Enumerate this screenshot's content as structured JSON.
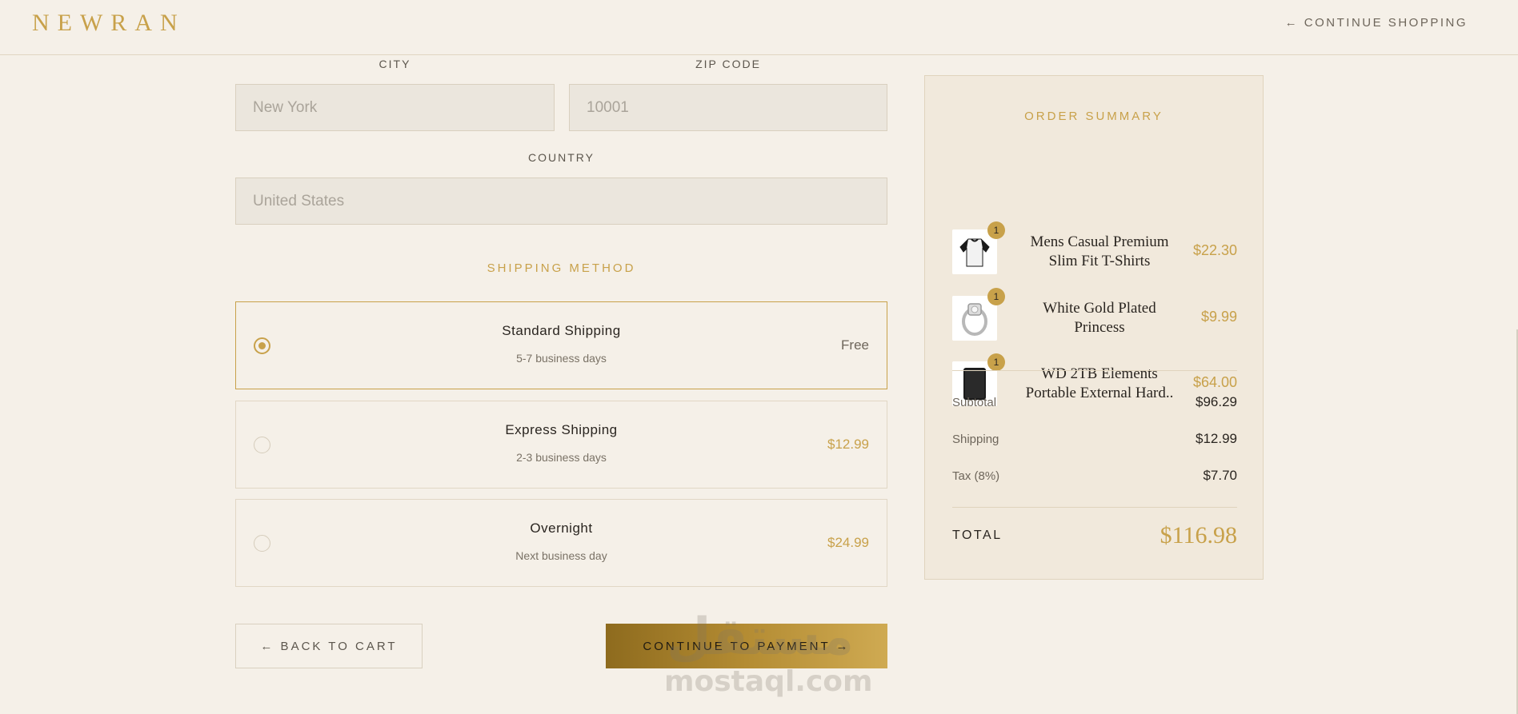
{
  "header": {
    "logo": "NEWRAN",
    "continue_shopping": "← CONTINUE SHOPPING"
  },
  "form": {
    "city_label": "CITY",
    "city_value": "New York",
    "zip_label": "ZIP CODE",
    "zip_value": "10001",
    "country_label": "COUNTRY",
    "country_value": "United States"
  },
  "shipping": {
    "title": "SHIPPING METHOD",
    "options": [
      {
        "name": "Standard Shipping",
        "days": "5-7 business days",
        "price": "Free",
        "selected": true
      },
      {
        "name": "Express Shipping",
        "days": "2-3 business days",
        "price": "$12.99",
        "selected": false
      },
      {
        "name": "Overnight",
        "days": "Next business day",
        "price": "$24.99",
        "selected": false
      }
    ]
  },
  "actions": {
    "back": "← BACK TO CART",
    "continue": "CONTINUE TO PAYMENT →"
  },
  "watermark": {
    "arabic": "مستقل",
    "latin": "mostaql.com"
  },
  "summary": {
    "title": "ORDER SUMMARY",
    "items": [
      {
        "qty": "1",
        "name": "Mens Casual Premium Slim Fit T-Shirts",
        "price": "$22.30",
        "icon": "tshirt-thumbnail"
      },
      {
        "qty": "1",
        "name": "White Gold Plated Princess",
        "price": "$9.99",
        "icon": "ring-thumbnail"
      },
      {
        "qty": "1",
        "name": "WD 2TB Elements Portable External Hard..",
        "price": "$64.00",
        "icon": "hard-drive-thumbnail"
      }
    ],
    "subtotal_label": "Subtotal",
    "subtotal": "$96.29",
    "shipping_label": "Shipping",
    "shipping": "$12.99",
    "tax_label": "Tax (8%)",
    "tax": "$7.70",
    "total_label": "TOTAL",
    "total": "$116.98"
  },
  "colors": {
    "background": "#f5f0e8",
    "accent_gold": "#c8a14a",
    "panel": "#f1e9dc"
  }
}
